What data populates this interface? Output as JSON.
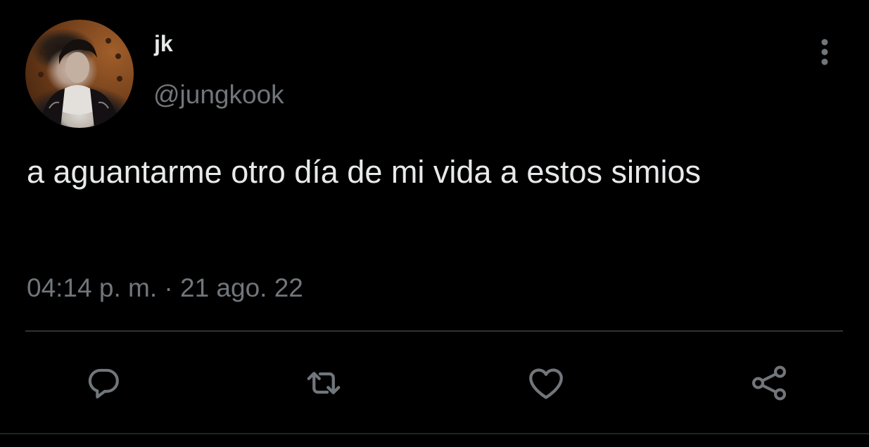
{
  "tweet": {
    "author": {
      "display_name": "jk",
      "handle": "@jungkook"
    },
    "text": "a aguantarme otro día de mi vida a estos simios",
    "time": "04:14 p. m.",
    "separator": "·",
    "date": "21 ago. 22"
  },
  "icons": {
    "more": "more-vertical-icon",
    "reply": "reply-bubble-icon",
    "retweet": "retweet-icon",
    "like": "heart-icon",
    "share": "share-icon"
  },
  "colors": {
    "background": "#000000",
    "primary_text": "#e7e9ea",
    "secondary_text": "#71767b",
    "divider": "#2f3336",
    "icon": "#71767b"
  }
}
